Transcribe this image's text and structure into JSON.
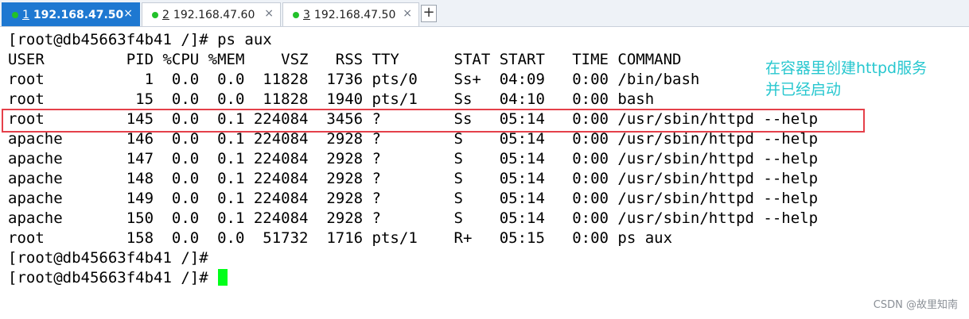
{
  "tabs": [
    {
      "number": "1",
      "label": "192.168.47.50",
      "active": true,
      "status_color": "#22c12a"
    },
    {
      "number": "2",
      "label": "192.168.47.60",
      "active": false,
      "status_color": "#22c12a"
    },
    {
      "number": "3",
      "label": "192.168.47.50",
      "active": false,
      "status_color": "#22c12a"
    }
  ],
  "tab_close_glyph": "×",
  "add_tab_glyph": "+",
  "terminal": {
    "lines": [
      "[root@db45663f4b41 /]# ps aux",
      "USER         PID %CPU %MEM    VSZ   RSS TTY      STAT START   TIME COMMAND",
      "root           1  0.0  0.0  11828  1736 pts/0    Ss+  04:09   0:00 /bin/bash",
      "root          15  0.0  0.0  11828  1940 pts/1    Ss   04:10   0:00 bash",
      "root         145  0.0  0.1 224084  3456 ?        Ss   05:14   0:00 /usr/sbin/httpd --help",
      "apache       146  0.0  0.1 224084  2928 ?        S    05:14   0:00 /usr/sbin/httpd --help",
      "apache       147  0.0  0.1 224084  2928 ?        S    05:14   0:00 /usr/sbin/httpd --help",
      "apache       148  0.0  0.1 224084  2928 ?        S    05:14   0:00 /usr/sbin/httpd --help",
      "apache       149  0.0  0.1 224084  2928 ?        S    05:14   0:00 /usr/sbin/httpd --help",
      "apache       150  0.0  0.1 224084  2928 ?        S    05:14   0:00 /usr/sbin/httpd --help",
      "root         158  0.0  0.0  51732  1716 pts/1    R+   05:15   0:00 ps aux",
      "[root@db45663f4b41 /]#",
      "[root@db45663f4b41 /]# "
    ],
    "cursor_color": "#00ff1a",
    "highlight_color": "#e5404a"
  },
  "annotation": {
    "line1": "在容器里创建httpd服务",
    "line2": "并已经启动",
    "color": "#27c7cf"
  },
  "watermark": "CSDN @故里知南"
}
